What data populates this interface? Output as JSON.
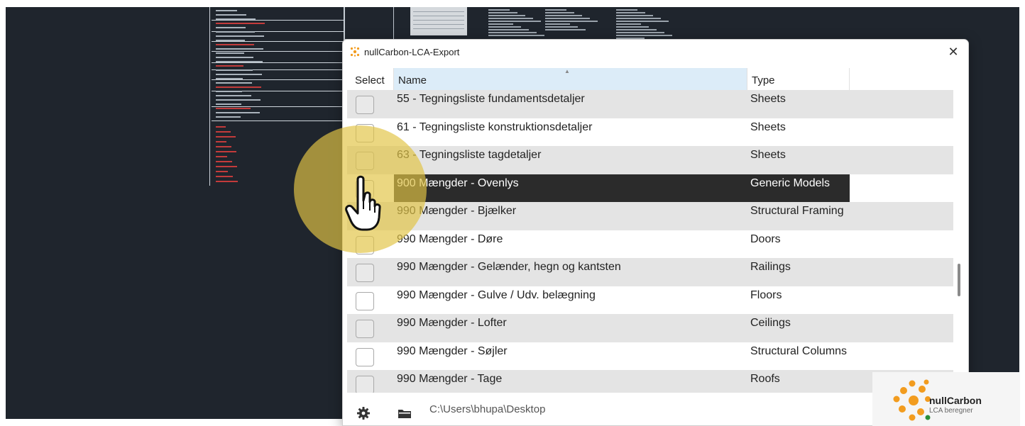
{
  "dialog": {
    "title": "nullCarbon-LCA-Export",
    "close_glyph": "✕",
    "columns": {
      "select": "Select",
      "name": "Name",
      "type": "Type"
    },
    "sort_glyph": "▲",
    "rows": [
      {
        "name": "55 - Tegningsliste fundamentsdetaljer",
        "type": "Sheets",
        "selected": false
      },
      {
        "name": "61 - Tegningsliste konstruktionsdetaljer",
        "type": "Sheets",
        "selected": false
      },
      {
        "name": "63 - Tegningsliste tagdetaljer",
        "type": "Sheets",
        "selected": false
      },
      {
        "name": "900 Mængder - Ovenlys",
        "type": "Generic Models",
        "selected": true
      },
      {
        "name": "990 Mængder - Bjælker",
        "type": "Structural Framing",
        "selected": false
      },
      {
        "name": "990 Mængder - Døre",
        "type": "Doors",
        "selected": false
      },
      {
        "name": "990 Mængder - Gelænder, hegn og kantsten",
        "type": "Railings",
        "selected": false
      },
      {
        "name": "990 Mængder - Gulve / Udv. belægning",
        "type": "Floors",
        "selected": false
      },
      {
        "name": "990 Mængder - Lofter",
        "type": "Ceilings",
        "selected": false
      },
      {
        "name": "990 Mængder - Søjler",
        "type": "Structural Columns",
        "selected": false
      },
      {
        "name": "990 Mængder - Tage",
        "type": "Roofs",
        "selected": false
      }
    ],
    "footer": {
      "path": "C:\\Users\\bhupa\\Desktop"
    }
  },
  "icons": {
    "title": "nullcarbon-logo-icon",
    "settings": "gear-icon",
    "folder": "folder-icon",
    "cursor": "hand-pointer-icon"
  },
  "logo": {
    "name": "nullCarbon",
    "subtitle": "LCA beregner"
  },
  "colors": {
    "backdrop": "#1f252d",
    "header_sorted": "#dcecf8",
    "row_alt": "#e4e4e4",
    "row_selected": "#2b2b2b",
    "click_highlight": "#e2c446",
    "brand_orange": "#f29c1f"
  }
}
